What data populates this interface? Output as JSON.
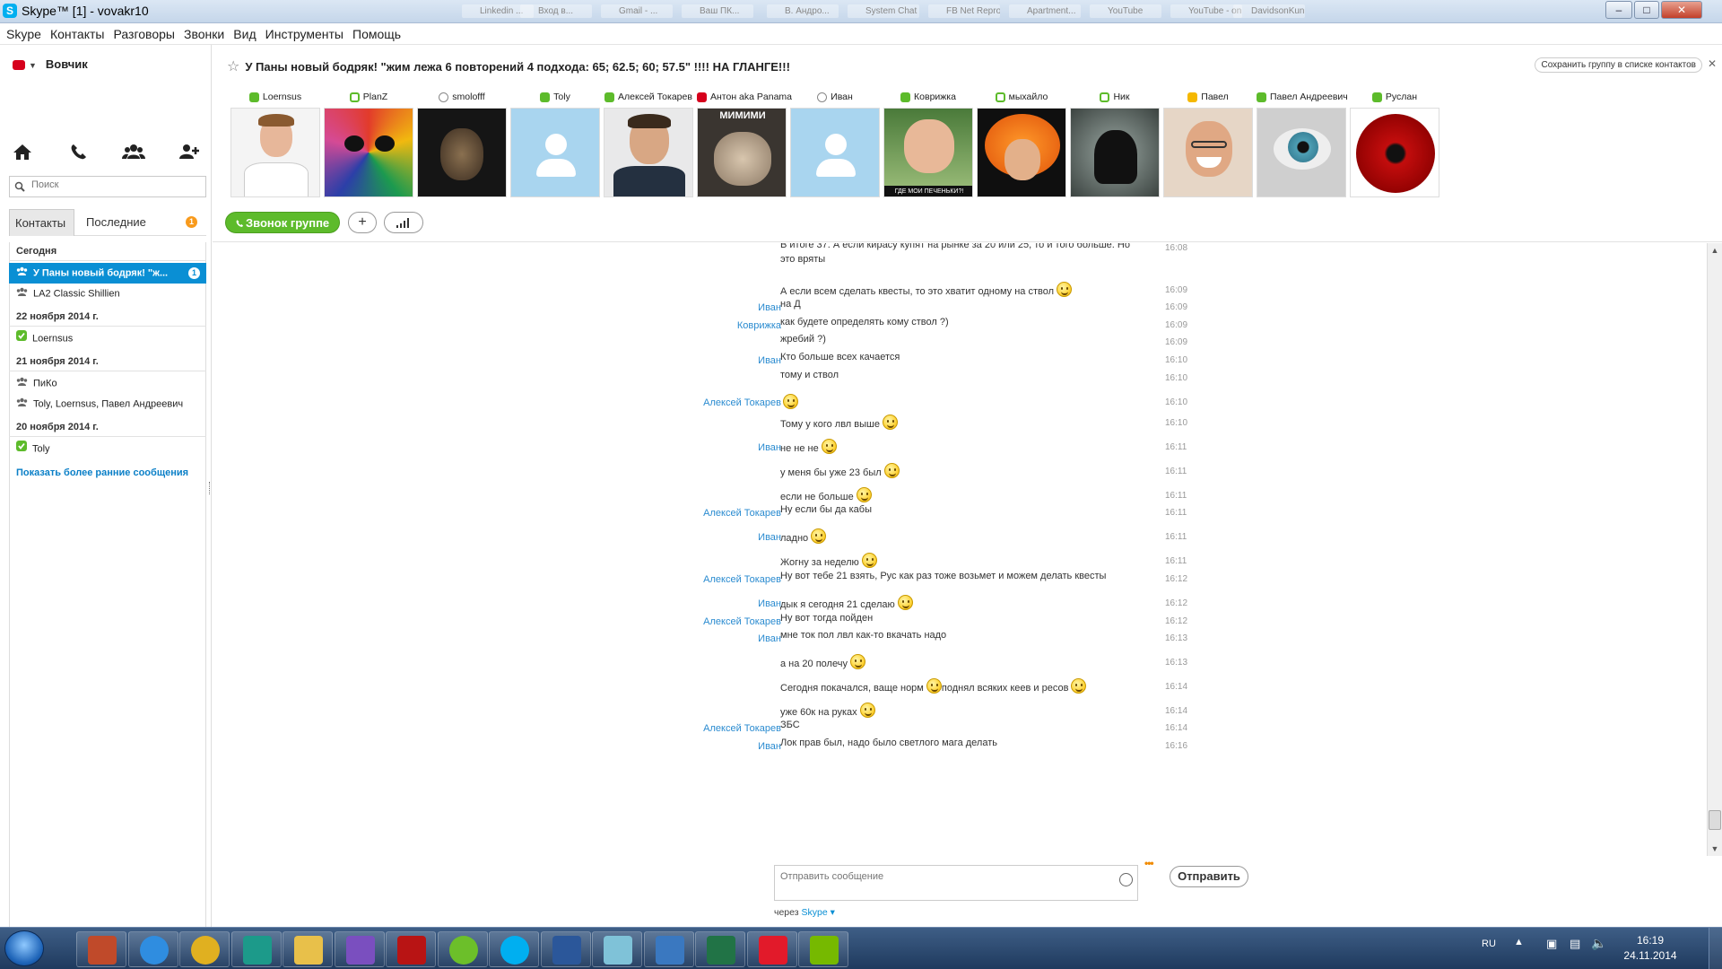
{
  "window": {
    "title": "Skype™ [1] - vovakr10",
    "ghost_tabs": [
      "",
      "",
      "Linkedin ...",
      "Вход в...",
      "Gmail - ...",
      "Ваш ПК...",
      "В. Андро...",
      "System Chat",
      "FB Net Repro...",
      "Apartment...",
      "YouTube",
      "YouTube - on...",
      "DavidsonKun..."
    ]
  },
  "menu": [
    "Skype",
    "Контакты",
    "Разговоры",
    "Звонки",
    "Вид",
    "Инструменты",
    "Помощь"
  ],
  "sidebar": {
    "user": "Вовчик",
    "search_placeholder": "Поиск",
    "tabs": {
      "contacts": "Контакты",
      "recent": "Последние",
      "badge": "1"
    },
    "groups": [
      {
        "header": "Сегодня",
        "items": [
          {
            "label": "У Паны новый бодряк! \"ж...",
            "type": "group",
            "selected": true,
            "count": "1"
          },
          {
            "label": "LA2 Classic Shillien",
            "type": "group"
          }
        ]
      },
      {
        "header": "22 ноября 2014 г.",
        "items": [
          {
            "label": "Loernsus",
            "type": "online"
          }
        ]
      },
      {
        "header": "21 ноября 2014 г.",
        "items": [
          {
            "label": "ПиКо",
            "type": "group"
          },
          {
            "label": "Toly, Loernsus, Павел Андреевич",
            "type": "group"
          }
        ]
      },
      {
        "header": "20 ноября 2014 г.",
        "items": [
          {
            "label": "Toly",
            "type": "online"
          }
        ]
      }
    ],
    "show_more": "Показать более ранние сообщения"
  },
  "conversation": {
    "topic": "У Паны новый бодряк! \"жим лежа 6 повторений 4 подхода: 65; 62.5; 60; 57.5\" !!!! НА ГЛАНГЕ!!!",
    "save_group": "Сохранить группу в списке контактов",
    "participants": [
      {
        "name": "Loernsus",
        "status": "online",
        "avatar": "man-white-shirt"
      },
      {
        "name": "PlanZ",
        "status": "online-empty",
        "avatar": "colorful-mask"
      },
      {
        "name": "smolofff",
        "status": "phone",
        "avatar": "dark-face"
      },
      {
        "name": "Toly",
        "status": "online",
        "avatar": "placeholder"
      },
      {
        "name": "Алексей Токарев",
        "status": "online",
        "avatar": "man-dark-shirt"
      },
      {
        "name": "Антон aka Panama",
        "status": "busy",
        "avatar": "cat"
      },
      {
        "name": "Иван",
        "status": "phone",
        "avatar": "placeholder"
      },
      {
        "name": "Коврижка",
        "status": "online",
        "avatar": "success-kid"
      },
      {
        "name": "мыхайло",
        "status": "online-empty",
        "avatar": "orange-hair"
      },
      {
        "name": "Ник",
        "status": "online-empty",
        "avatar": "vader"
      },
      {
        "name": "Павел",
        "status": "away",
        "avatar": "laughing-man"
      },
      {
        "name": "Павел Андреевич",
        "status": "online",
        "avatar": "eye"
      },
      {
        "name": "Руслан",
        "status": "online",
        "avatar": "sharingan"
      }
    ],
    "avatar_captions": {
      "cat": "МИМИМИ",
      "success-kid": "ГДЕ МОИ ПЕЧЕНЬКИ?!"
    },
    "call_button": "Звонок группе",
    "add_button": "+",
    "messages": [
      {
        "from": "",
        "text": "В итоге 37. А если кирасу купят на рынке за 20 или 25, то и того больше. Но",
        "text2": "это вряты",
        "time": "16:08",
        "smile": false
      },
      {
        "from": "",
        "text": "А если всем сделать квесты, то это хватит одному на ствол",
        "time": "16:09",
        "smile": true
      },
      {
        "from": "Иван",
        "text": "на Д",
        "time": "16:09",
        "smile": false
      },
      {
        "from": "Коврижка",
        "text": "как будете определять кому ствол ?)",
        "time": "16:09",
        "smile": false
      },
      {
        "from": "",
        "text": "жребий ?)",
        "time": "16:09",
        "smile": false
      },
      {
        "from": "Иван",
        "text": "Кто больше всех качается",
        "time": "16:10",
        "smile": false
      },
      {
        "from": "",
        "text": "тому и ствол",
        "time": "16:10",
        "smile": false
      },
      {
        "from": "Алексей Токарев",
        "text": "",
        "time": "16:10",
        "smile": true
      },
      {
        "from": "",
        "text": "Тому у кого лвл выше",
        "time": "16:10",
        "smile": true
      },
      {
        "from": "Иван",
        "text": "не не не",
        "time": "16:11",
        "smile": true
      },
      {
        "from": "",
        "text": "у меня бы уже 23 был",
        "time": "16:11",
        "smile": true
      },
      {
        "from": "",
        "text": "если не больше",
        "time": "16:11",
        "smile": true
      },
      {
        "from": "Алексей Токарев",
        "text": "Ну если бы да кабы",
        "time": "16:11",
        "smile": false
      },
      {
        "from": "Иван",
        "text": "ладно",
        "time": "16:11",
        "smile": true
      },
      {
        "from": "",
        "text": "Жогну за неделю",
        "time": "16:11",
        "smile": true
      },
      {
        "from": "Алексей Токарев",
        "text": "Ну вот тебе 21 взять, Рус как раз тоже возьмет и можем делать квесты",
        "time": "16:12",
        "smile": false
      },
      {
        "from": "Иван",
        "text": "дык я сегодня 21 сделаю",
        "time": "16:12",
        "smile": true
      },
      {
        "from": "Алексей Токарев",
        "text": "Ну вот тогда пойден",
        "time": "16:12",
        "smile": false
      },
      {
        "from": "Иван",
        "text": "мне ток пол лвл как-то вкачать надо",
        "time": "16:13",
        "smile": false
      },
      {
        "from": "",
        "text": "а на 20 полечу",
        "time": "16:13",
        "smile": true
      },
      {
        "from": "",
        "text": "Сегодня покачался, ваще норм",
        "text_after": "поднял всяких кеев и ресов",
        "time": "16:14",
        "smile": true,
        "smile2": true
      },
      {
        "from": "",
        "text": "уже 60к на руках",
        "time": "16:14",
        "smile": true
      },
      {
        "from": "Алексей Токарев",
        "text": "ЗБС",
        "time": "16:14",
        "smile": false
      },
      {
        "from": "Иван",
        "text": "Лок прав был, надо было светлого мага делать",
        "time": "16:16",
        "smile": false
      }
    ],
    "input_placeholder": "Отправить сообщение",
    "send_button": "Отправить",
    "via_label": "через",
    "via_service": "Skype"
  },
  "taskbar": {
    "apps": [
      "paint",
      "internet-explorer",
      "chrome",
      "autocad",
      "explorer",
      "visual-studio",
      "adobe",
      "utorrent",
      "skype",
      "word",
      "notepad",
      "stylus",
      "excel",
      "daemon",
      "nvidia"
    ],
    "lang": "RU",
    "time": "16:19",
    "date": "24.11.2014"
  },
  "colors": {
    "accent": "#0a8fd4",
    "online": "#5dbb2b",
    "busy": "#d6001c",
    "away": "#f5b800",
    "sender": "#2a8bd0"
  }
}
